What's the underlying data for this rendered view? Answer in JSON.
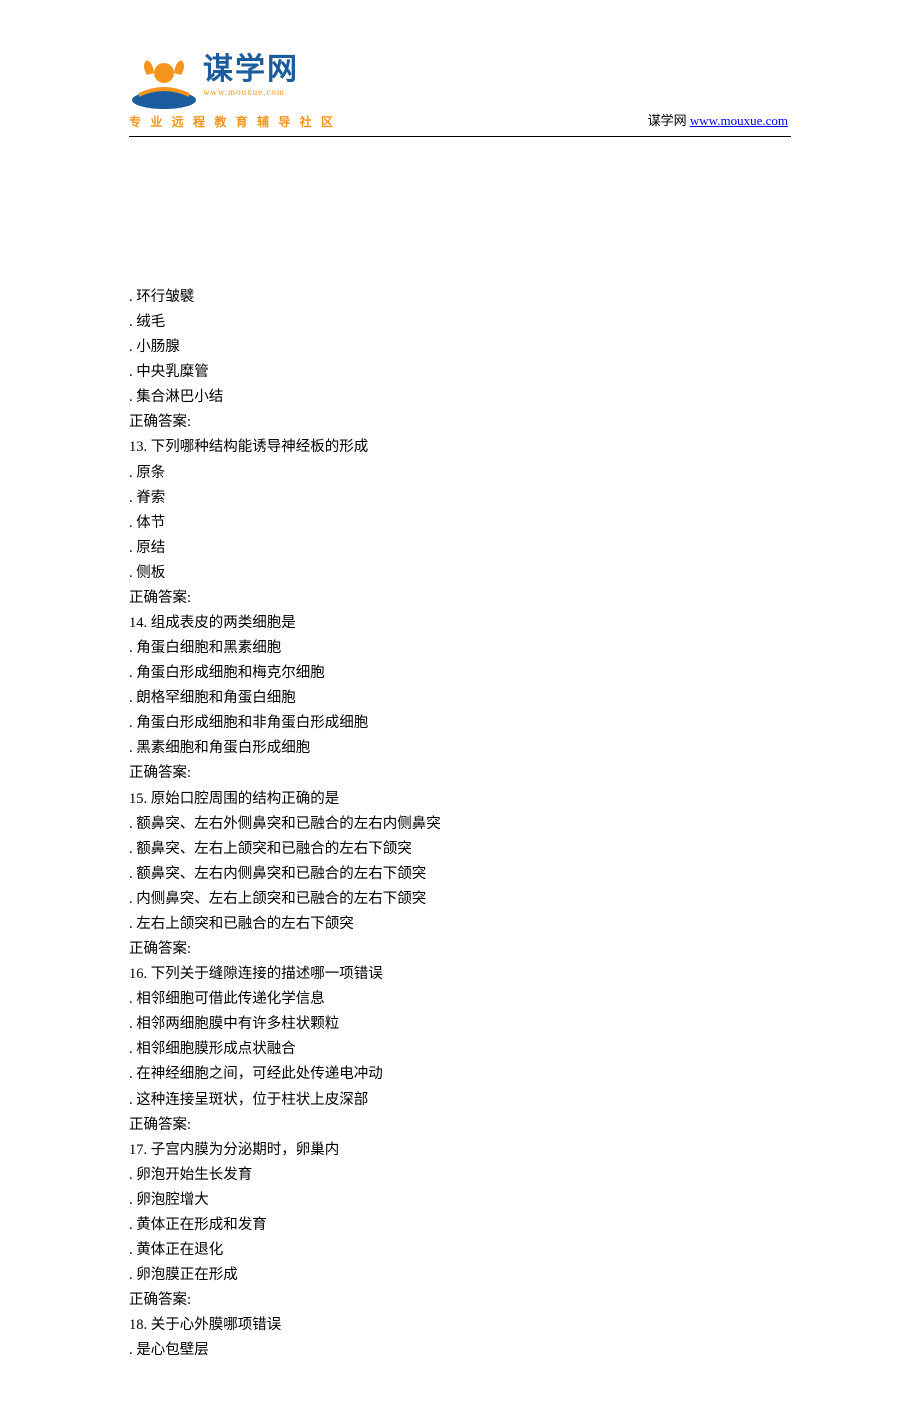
{
  "header": {
    "logo_main": "谋学网",
    "logo_sub": "www.mouxue.com",
    "tagline": "专 业 远 程 教 育 辅 导 社 区",
    "right_text": "谋学网 ",
    "right_link": "www.mouxue.com"
  },
  "lines": [
    ". 环行皱襞",
    ". 绒毛",
    ". 小肠腺",
    ". 中央乳糜管",
    ". 集合淋巴小结",
    "正确答案:",
    "13. 下列哪种结构能诱导神经板的形成",
    ". 原条",
    ". 脊索",
    ". 体节",
    ". 原结",
    ". 侧板",
    "正确答案:",
    "14. 组成表皮的两类细胞是",
    ". 角蛋白细胞和黑素细胞",
    ". 角蛋白形成细胞和梅克尔细胞",
    ". 朗格罕细胞和角蛋白细胞",
    ". 角蛋白形成细胞和非角蛋白形成细胞",
    ". 黑素细胞和角蛋白形成细胞",
    "正确答案:",
    "15. 原始口腔周围的结构正确的是",
    ". 额鼻突、左右外侧鼻突和已融合的左右内侧鼻突",
    ". 额鼻突、左右上颌突和已融合的左右下颌突",
    ". 额鼻突、左右内侧鼻突和已融合的左右下颌突",
    ". 内侧鼻突、左右上颌突和已融合的左右下颌突",
    ". 左右上颌突和已融合的左右下颌突",
    "正确答案:",
    "16. 下列关于缝隙连接的描述哪一项错误",
    ". 相邻细胞可借此传递化学信息",
    ". 相邻两细胞膜中有许多柱状颗粒",
    ". 相邻细胞膜形成点状融合",
    ". 在神经细胞之间，可经此处传递电冲动",
    ". 这种连接呈斑状，位于柱状上皮深部",
    "正确答案:",
    "17. 子宫内膜为分泌期时，卵巢内",
    ". 卵泡开始生长发育",
    ". 卵泡腔增大",
    ". 黄体正在形成和发育",
    ". 黄体正在退化",
    ". 卵泡膜正在形成",
    "正确答案:",
    "18. 关于心外膜哪项错误",
    ". 是心包壁层"
  ]
}
